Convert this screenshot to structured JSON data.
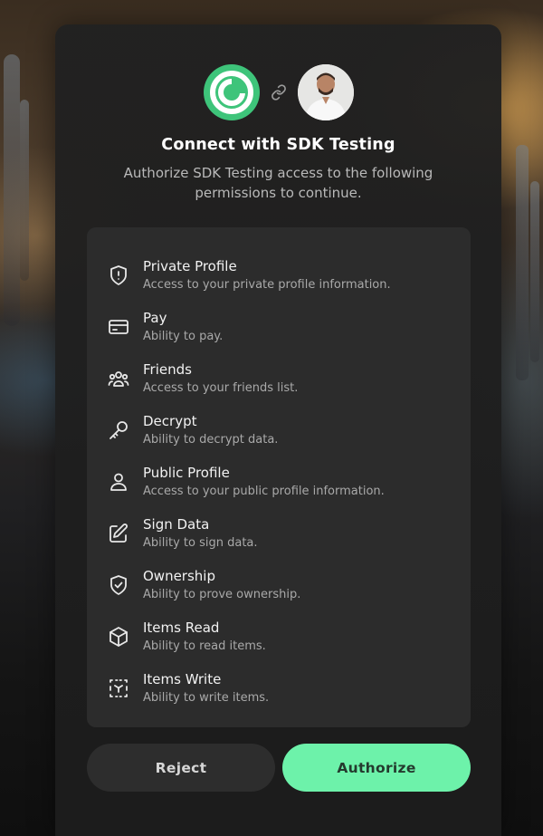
{
  "header": {
    "title": "Connect with SDK Testing",
    "subtitle": "Authorize SDK Testing access to the following permissions to continue."
  },
  "icons": {
    "app_logo": "app-logo-icon",
    "link": "link-icon",
    "user_avatar": "user-avatar"
  },
  "permissions": [
    {
      "name": "Private Profile",
      "description": "Access to your private profile information.",
      "icon": "shield-alert-icon"
    },
    {
      "name": "Pay",
      "description": "Ability to pay.",
      "icon": "credit-card-icon"
    },
    {
      "name": "Friends",
      "description": "Access to your friends list.",
      "icon": "users-icon"
    },
    {
      "name": "Decrypt",
      "description": "Ability to decrypt data.",
      "icon": "key-icon"
    },
    {
      "name": "Public Profile",
      "description": "Access to your public profile information.",
      "icon": "user-icon"
    },
    {
      "name": "Sign Data",
      "description": "Ability to sign data.",
      "icon": "edit-icon"
    },
    {
      "name": "Ownership",
      "description": "Ability to prove ownership.",
      "icon": "shield-check-icon"
    },
    {
      "name": "Items Read",
      "description": "Ability to read items.",
      "icon": "box-icon"
    },
    {
      "name": "Items Write",
      "description": "Ability to write items.",
      "icon": "box-select-icon"
    }
  ],
  "actions": {
    "reject_label": "Reject",
    "authorize_label": "Authorize"
  },
  "colors": {
    "accent": "#6df2aa",
    "app_logo": "#3ec47a",
    "card_bg": "#212121",
    "panel_bg": "#2c2c2c"
  }
}
